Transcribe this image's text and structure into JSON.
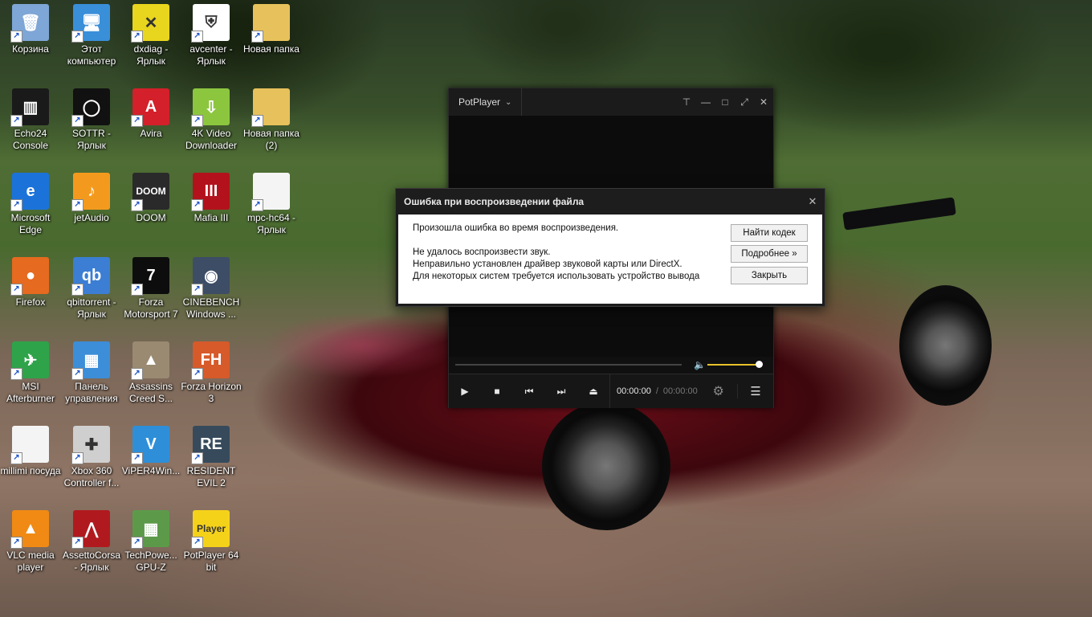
{
  "desktop": {
    "icons": [
      {
        "label": "Корзина",
        "glyph": "🗑",
        "color": "#7ea6d6"
      },
      {
        "label": "Этот компьютер",
        "glyph": "🖥",
        "color": "#3a8fd9"
      },
      {
        "label": "dxdiag - Ярлык",
        "glyph": "✕",
        "color": "#e8d51d"
      },
      {
        "label": "avcenter - Ярлык",
        "glyph": "⛨",
        "color": "#ffffff"
      },
      {
        "label": "Новая папка",
        "glyph": "",
        "color": "#e7c15b"
      },
      {
        "label": "Echo24 Console",
        "glyph": "▥",
        "color": "#1a1a1a"
      },
      {
        "label": "SOTTR - Ярлык",
        "glyph": "◯",
        "color": "#111111"
      },
      {
        "label": "Avira",
        "glyph": "A",
        "color": "#d3202a"
      },
      {
        "label": "4K Video Downloader",
        "glyph": "⇩",
        "color": "#8cc63f"
      },
      {
        "label": "Новая папка (2)",
        "glyph": "",
        "color": "#e7c15b"
      },
      {
        "label": "Microsoft Edge",
        "glyph": "e",
        "color": "#1b73d9"
      },
      {
        "label": "jetAudio",
        "glyph": "♪",
        "color": "#f39a1e"
      },
      {
        "label": "DOOM",
        "glyph": "DOOM",
        "color": "#2a2a2a"
      },
      {
        "label": "Mafia III",
        "glyph": "III",
        "color": "#b3121c"
      },
      {
        "label": "mpc-hc64 - Ярлык",
        "glyph": "",
        "color": "#f4f4f4"
      },
      {
        "label": "Firefox",
        "glyph": "●",
        "color": "#e66a1f"
      },
      {
        "label": "qbittorrent - Ярлык",
        "glyph": "qb",
        "color": "#3b7ed3"
      },
      {
        "label": "Forza Motorsport 7",
        "glyph": "7",
        "color": "#0d0d0d"
      },
      {
        "label": "CINEBENCH Windows ...",
        "glyph": "◉",
        "color": "#3d4d66"
      },
      {
        "label": "MSI Afterburner",
        "glyph": "✈",
        "color": "#2fa34a"
      },
      {
        "label": "Панель управления",
        "glyph": "▦",
        "color": "#3d8ed8"
      },
      {
        "label": "Assassins Creed S...",
        "glyph": "▲",
        "color": "#9a8a72"
      },
      {
        "label": "Forza Horizon 3",
        "glyph": "FH",
        "color": "#d65a2a"
      },
      {
        "label": "millimi посуда",
        "glyph": "",
        "color": "#f4f4f4"
      },
      {
        "label": "Xbox 360 Controller f...",
        "glyph": "✚",
        "color": "#cfcfcf"
      },
      {
        "label": "ViPER4Win...",
        "glyph": "V",
        "color": "#2e8fd8"
      },
      {
        "label": "RESIDENT EVIL 2",
        "glyph": "RE",
        "color": "#364a5c"
      },
      {
        "label": "VLC media player",
        "glyph": "▲",
        "color": "#f08a14"
      },
      {
        "label": "AssettoCorsa - Ярлык",
        "glyph": "⋀",
        "color": "#b01a1f"
      },
      {
        "label": "TechPowe... GPU-Z",
        "glyph": "▦",
        "color": "#5c9a4a"
      },
      {
        "label": "PotPlayer 64 bit",
        "glyph": "Player",
        "color": "#f5d21a"
      }
    ]
  },
  "potplayer": {
    "title": "PotPlayer",
    "chevron": "⌄",
    "controls": {
      "pin": "⊤",
      "minimize": "—",
      "maximize": "□",
      "fullscreen": "⤢",
      "close": "✕"
    },
    "volume_level": 1.0,
    "buttons": {
      "play": "▶",
      "stop": "■",
      "prev": "⏮",
      "next": "⏭",
      "eject": "⏏"
    },
    "time_current": "00:00:00",
    "time_separator": "/",
    "time_total": "00:00:00",
    "gear": "⚙",
    "menu": "☰",
    "volume_icon": "🔈"
  },
  "dialog": {
    "title": "Ошибка при воспроизведении файла",
    "close": "✕",
    "line1": "Произошла ошибка во время воспроизведения.",
    "line2": "Не удалось воспроизвести звук.",
    "line3": "Неправильно установлен драйвер звуковой карты или DirectX.",
    "line4": "Для некоторых систем требуется использовать устройство вывода",
    "btn_codec": "Найти кодек",
    "btn_more": "Подробнее »",
    "btn_close": "Закрыть"
  }
}
